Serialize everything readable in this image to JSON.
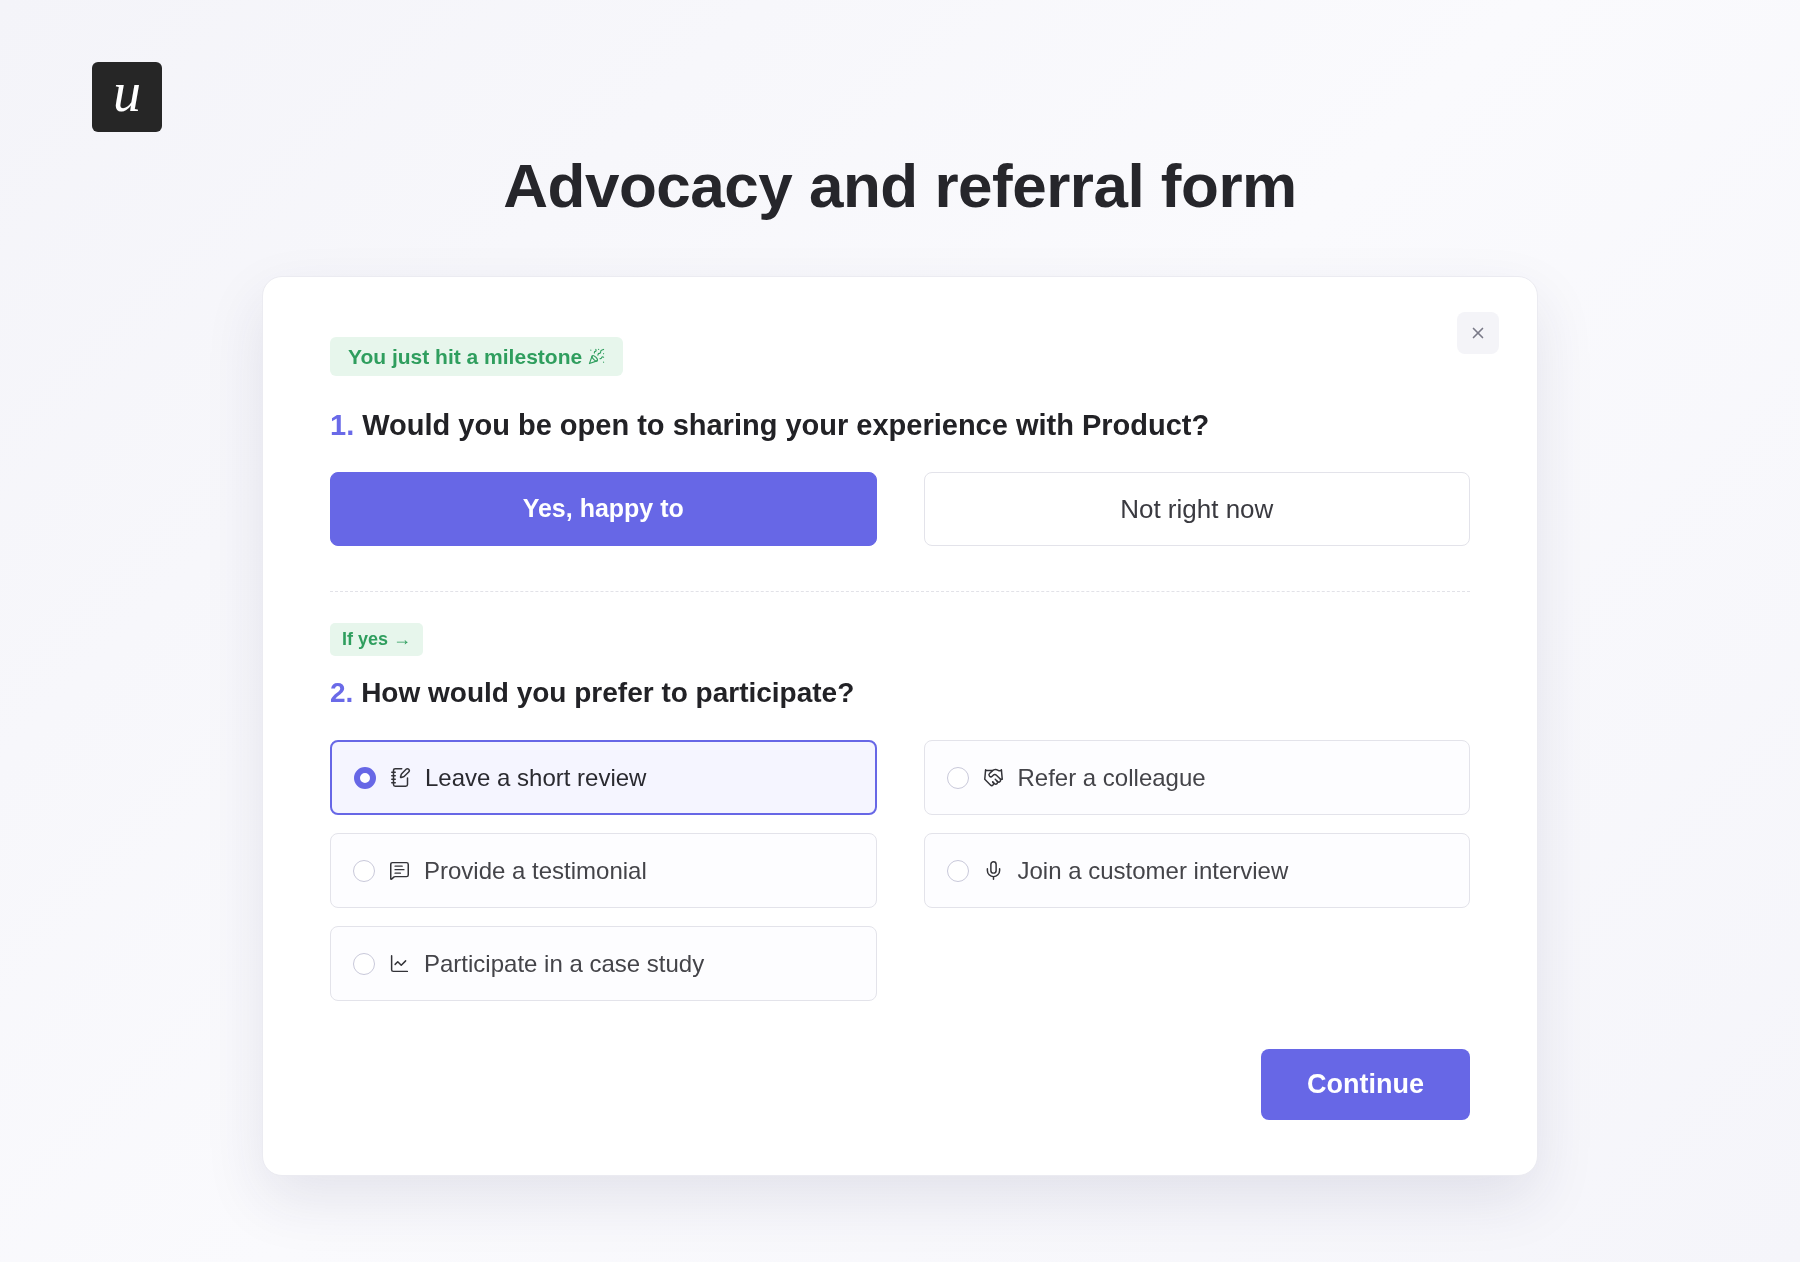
{
  "logo": {
    "letter": "u"
  },
  "title": "Advocacy and referral form",
  "form": {
    "milestone_badge": "You just hit a milestone",
    "question_1": {
      "number": "1.",
      "text": "Would you be open to sharing your experience with Product?",
      "answers": [
        {
          "label": "Yes, happy to",
          "selected": true
        },
        {
          "label": "Not right now",
          "selected": false
        }
      ]
    },
    "condition_badge": "If yes →",
    "question_2": {
      "number": "2.",
      "text": "How would you prefer to participate?",
      "options": [
        {
          "label": "Leave a short review",
          "selected": true
        },
        {
          "label": "Refer a colleague",
          "selected": false
        },
        {
          "label": "Provide a testimonial",
          "selected": false
        },
        {
          "label": "Join a customer interview",
          "selected": false
        },
        {
          "label": "Participate in a case study",
          "selected": false
        }
      ]
    },
    "continue_button": "Continue"
  }
}
